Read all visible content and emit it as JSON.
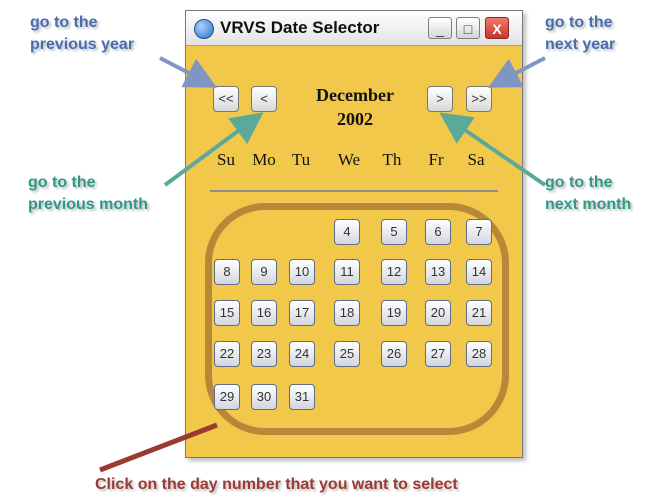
{
  "window": {
    "title": "VRVS Date Selector",
    "minimize_label": "_",
    "maximize_label": "□",
    "close_label": "X"
  },
  "nav": {
    "prev_year": "<<",
    "prev_month": "<",
    "next_month": ">",
    "next_year": ">>",
    "month": "December",
    "year": "2002"
  },
  "weekdays": [
    "Su",
    "Mo",
    "Tu",
    "We",
    "Th",
    "Fr",
    "Sa"
  ],
  "days": [
    "4",
    "5",
    "6",
    "7",
    "8",
    "9",
    "10",
    "11",
    "12",
    "13",
    "14",
    "15",
    "16",
    "17",
    "18",
    "19",
    "20",
    "21",
    "22",
    "23",
    "24",
    "25",
    "26",
    "27",
    "28",
    "29",
    "30",
    "31"
  ],
  "callouts": {
    "prev_year": [
      "go to the",
      "previous year"
    ],
    "next_year": [
      "go to the",
      "next year"
    ],
    "prev_month": [
      "go to the",
      "previous month"
    ],
    "next_month": [
      "go to the",
      "next month"
    ],
    "select_day": "Click on the day number that you want to select"
  },
  "colors": {
    "window_bg": "#f1c84a",
    "callout_blue": "#4a6cb0",
    "callout_teal": "#2e9a86",
    "callout_brown": "#9a3a30",
    "oval": "#b8883a"
  }
}
